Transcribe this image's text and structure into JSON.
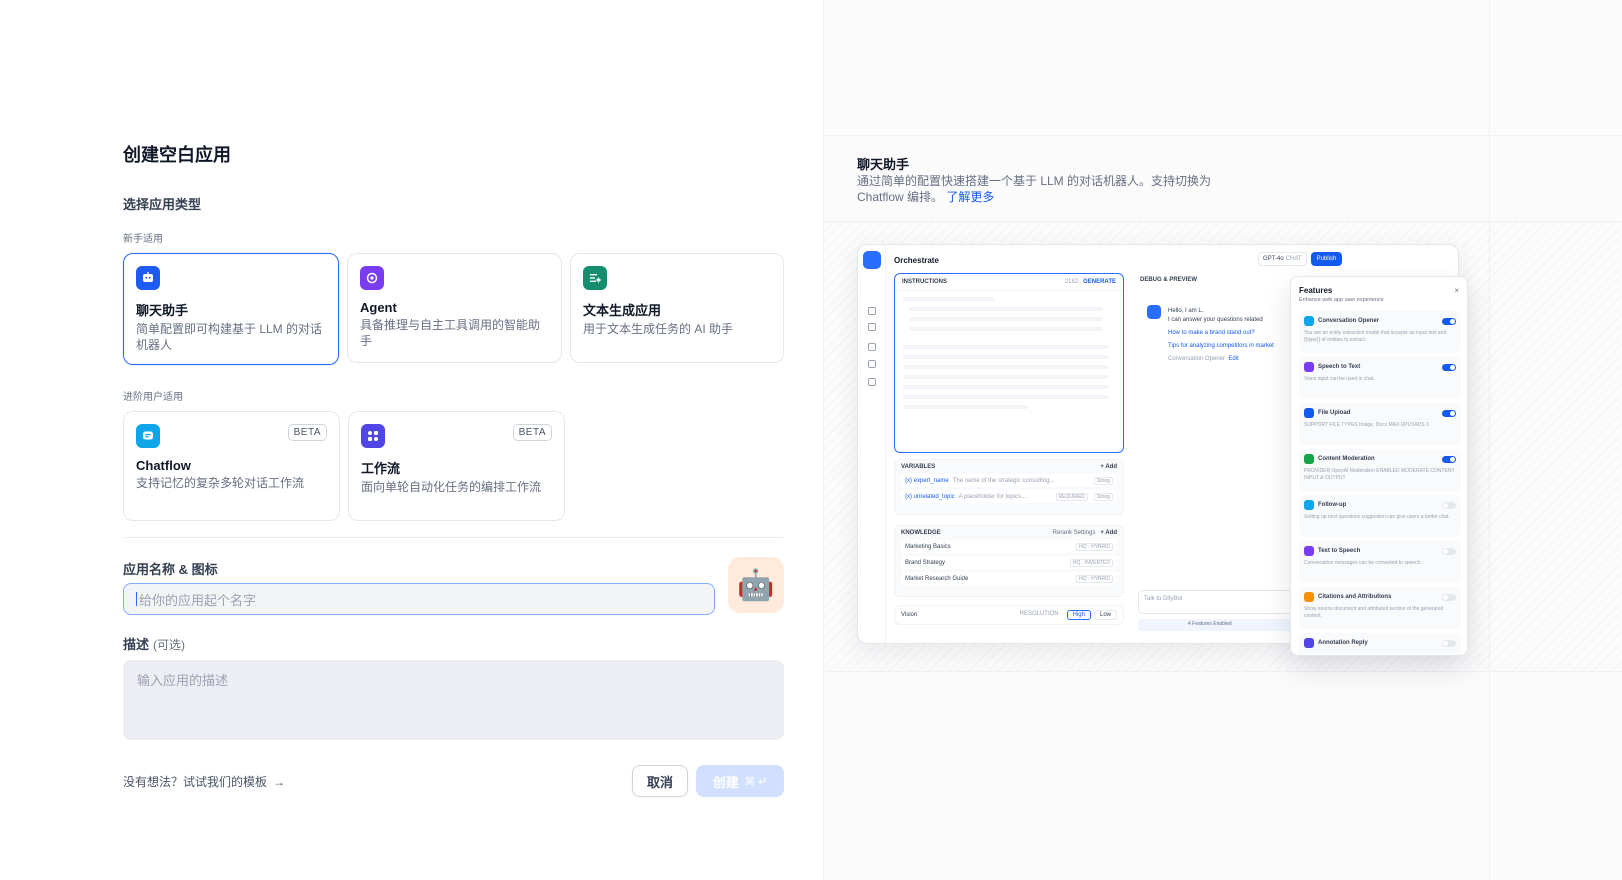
{
  "page": {
    "title": "创建空白应用",
    "section_app_type": "选择应用类型",
    "group_beginner": "新手适用",
    "group_advanced": "进阶用户适用"
  },
  "cards": {
    "chat": {
      "title": "聊天助手",
      "desc": "简单配置即可构建基于 LLM 的对话机器人",
      "icon": "chat-bot-icon",
      "color": "#1d5bf3"
    },
    "agent": {
      "title": "Agent",
      "desc": "具备推理与自主工具调用的智能助手",
      "icon": "agent-icon",
      "color": "#7a3cf1"
    },
    "completion": {
      "title": "文本生成应用",
      "desc": "用于文本生成任务的 AI 助手",
      "icon": "text-generation-icon",
      "color": "#148e6f"
    },
    "chatflow": {
      "title": "Chatflow",
      "desc": "支持记忆的复杂多轮对话工作流",
      "icon": "chatflow-icon",
      "color": "#0ea5e9",
      "badge": "BETA"
    },
    "workflow": {
      "title": "工作流",
      "desc": "面向单轮自动化任务的编排工作流",
      "icon": "workflow-icon",
      "color": "#4f46e5",
      "badge": "BETA"
    }
  },
  "form": {
    "name_label": "应用名称 & 图标",
    "name_placeholder": "给你的应用起个名字",
    "app_icon_emoji": "🤖",
    "desc_label": "描述",
    "desc_optional": "(可选)",
    "desc_placeholder": "输入应用的描述"
  },
  "footer": {
    "template_link": "没有想法？试试我们的模板",
    "arrow": "→",
    "cancel": "取消",
    "create": "创建",
    "create_shortcut": "⌘ ↵"
  },
  "preview": {
    "title": "聊天助手",
    "desc": "通过简单的配置快速搭建一个基于 LLM 的对话机器人。支持切换为 Chatflow 编排。",
    "learn_more": "了解更多",
    "mock": {
      "orchestrate": "Orchestrate",
      "model": "GPT-4o",
      "model_tag": "CHAT",
      "publish": "Publish",
      "instructions": "INSTRUCTIONS",
      "count": "2182",
      "generate": "GENERATE",
      "variables": "VARIABLES",
      "add": "+ Add",
      "var1_name": "{x} expert_name",
      "var1_desc": "The name of the strategic consulting...",
      "var1_type": "String",
      "var2_name": "{x} unrelated_topic",
      "var2_desc": "A placeholder for topics...",
      "var2_req": "REQUIRED",
      "var2_type": "String",
      "knowledge": "KNOWLEDGE",
      "rerank": "Rerank Settings",
      "kb1": "Marketing Basics",
      "kb1_tag": "HQ · HYBRID",
      "kb2": "Brand Strategy",
      "kb2_tag": "HQ · INVERTED",
      "kb3": "Market Research Guide",
      "kb3_tag": "HQ · HYBRID",
      "vision": "Vision",
      "resolution": "RESOLUTION",
      "high": "High",
      "low": "Low",
      "debug": "DEBUG & PREVIEW",
      "hello": "Hello, I am L.",
      "answer": "I can answer your questions related",
      "sugg1": "How to make a brand stand out?",
      "sugg2": "Tips for analyzing competitors in market",
      "opener": "Conversation Opener",
      "edit": "Edit",
      "talk": "Talk to DifyBot",
      "features_enabled": "4 Features Enabled"
    },
    "features": {
      "title": "Features",
      "subtitle": "Enhance web app user experience",
      "close": "×",
      "items": [
        {
          "name": "Conversation Opener",
          "desc": "You are an entity extraction model that accepts an input text and {{type}} of entities to extract.",
          "on": true,
          "color": "#0ea5e9"
        },
        {
          "name": "Speech to Text",
          "desc": "Voice input can be used in chat.",
          "on": true,
          "color": "#7a3cf1"
        },
        {
          "name": "File Upload",
          "desc": "SUPPORT FILE TYPES  Image, Docs   MAX UPLOADS  3",
          "on": true,
          "color": "#155aef"
        },
        {
          "name": "Content Moderation",
          "desc": "PROVIDER  OpenAI Moderation   ENABLED MODERATE CONTENT  INPUT & OUTPUT",
          "on": true,
          "color": "#16a34a"
        },
        {
          "name": "Follow-up",
          "desc": "Setting up next questions suggestion can give users a better chat.",
          "on": false,
          "color": "#0ea5e9"
        },
        {
          "name": "Text to Speech",
          "desc": "Conversation messages can be converted to speech.",
          "on": false,
          "color": "#7a3cf1"
        },
        {
          "name": "Citations and Attributions",
          "desc": "Show source document and attributed section of the generated content.",
          "on": false,
          "color": "#f79009"
        },
        {
          "name": "Annotation Reply",
          "desc": "",
          "on": false,
          "color": "#4f46e5"
        }
      ]
    }
  }
}
